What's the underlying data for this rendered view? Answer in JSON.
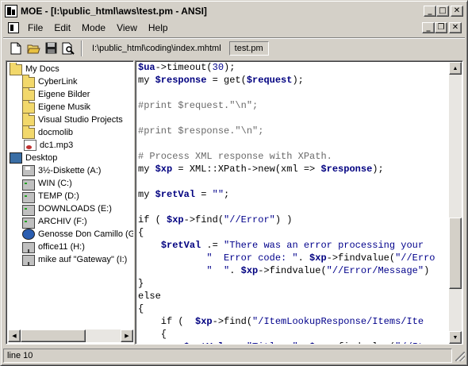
{
  "window": {
    "title": "MOE - [I:\\public_html\\aws\\test.pm - ANSI]",
    "buttons": {
      "minimize": "_",
      "maximize": "□",
      "close": "✕"
    }
  },
  "menubar": {
    "items": [
      "File",
      "Edit",
      "Mode",
      "View",
      "Help"
    ],
    "doc_buttons": {
      "minimize": "_",
      "restore": "❐",
      "close": "✕"
    }
  },
  "toolbar": {
    "icons": [
      "new-file-icon",
      "open-folder-icon",
      "save-disk-icon",
      "print-preview-icon"
    ],
    "tabs": [
      {
        "label": "I:\\public_html\\coding\\index.mhtml",
        "active": false
      },
      {
        "label": "test.pm",
        "active": true
      }
    ]
  },
  "tree": {
    "items": [
      {
        "label": "My Docs",
        "icon": "folder-icon",
        "level": 0
      },
      {
        "label": "CyberLink",
        "icon": "folder-icon",
        "level": 1
      },
      {
        "label": "Eigene Bilder",
        "icon": "folder-icon",
        "level": 1
      },
      {
        "label": "Eigene Musik",
        "icon": "folder-icon",
        "level": 1
      },
      {
        "label": "Visual Studio Projects",
        "icon": "folder-icon",
        "level": 1
      },
      {
        "label": "docmolib",
        "icon": "folder-icon",
        "level": 1
      },
      {
        "label": "dc1.mp3",
        "icon": "audio-file-icon",
        "level": 1
      },
      {
        "label": "Desktop",
        "icon": "desktop-icon",
        "level": 0
      },
      {
        "label": "3½-Diskette (A:)",
        "icon": "floppy-icon",
        "level": 1
      },
      {
        "label": "WIN (C:)",
        "icon": "drive-icon",
        "level": 1
      },
      {
        "label": "TEMP (D:)",
        "icon": "drive-icon",
        "level": 1
      },
      {
        "label": "DOWNLOADS (E:)",
        "icon": "drive-icon",
        "level": 1
      },
      {
        "label": "ARCHIV (F:)",
        "icon": "drive-icon",
        "level": 1
      },
      {
        "label": "Genosse Don Camillo (G:)",
        "icon": "network-icon",
        "level": 1
      },
      {
        "label": "office11 (H:)",
        "icon": "network-drive-icon",
        "level": 1
      },
      {
        "label": "mike auf \"Gateway\" (I:)",
        "icon": "network-drive-icon",
        "level": 1
      }
    ]
  },
  "editor": {
    "lines": [
      [
        [
          "var",
          "$ua"
        ],
        [
          "plain",
          "->timeout("
        ],
        [
          "str",
          "30"
        ],
        [
          "plain",
          ");"
        ]
      ],
      [
        [
          "plain",
          "my "
        ],
        [
          "var",
          "$response"
        ],
        [
          "plain",
          " = get("
        ],
        [
          "var",
          "$request"
        ],
        [
          "plain",
          ");"
        ]
      ],
      [
        [
          "plain",
          ""
        ]
      ],
      [
        [
          "cmt",
          "#print $request.\"\\n\";"
        ]
      ],
      [
        [
          "plain",
          ""
        ]
      ],
      [
        [
          "cmt",
          "#print $response.\"\\n\";"
        ]
      ],
      [
        [
          "plain",
          ""
        ]
      ],
      [
        [
          "cmt",
          "# Process XML response with XPath."
        ]
      ],
      [
        [
          "plain",
          "my "
        ],
        [
          "var",
          "$xp"
        ],
        [
          "plain",
          " = XML::XPath->new(xml => "
        ],
        [
          "var",
          "$response"
        ],
        [
          "plain",
          ");"
        ]
      ],
      [
        [
          "plain",
          ""
        ]
      ],
      [
        [
          "plain",
          "my "
        ],
        [
          "var",
          "$retVal"
        ],
        [
          "plain",
          " = "
        ],
        [
          "str",
          "\"\""
        ],
        [
          "plain",
          ";"
        ]
      ],
      [
        [
          "plain",
          ""
        ]
      ],
      [
        [
          "plain",
          "if ( "
        ],
        [
          "var",
          "$xp"
        ],
        [
          "plain",
          "->find("
        ],
        [
          "str",
          "\"//Error\""
        ],
        [
          "plain",
          ") )"
        ]
      ],
      [
        [
          "plain",
          "{"
        ]
      ],
      [
        [
          "plain",
          "    "
        ],
        [
          "var",
          "$retVal"
        ],
        [
          "plain",
          " .= "
        ],
        [
          "str",
          "\"There was an error processing your"
        ]
      ],
      [
        [
          "str",
          "            \"  Error code: \""
        ],
        [
          "plain",
          ". "
        ],
        [
          "var",
          "$xp"
        ],
        [
          "plain",
          "->findvalue("
        ],
        [
          "str",
          "\"//Erro"
        ]
      ],
      [
        [
          "str",
          "            \"  \""
        ],
        [
          "plain",
          ". "
        ],
        [
          "var",
          "$xp"
        ],
        [
          "plain",
          "->findvalue("
        ],
        [
          "str",
          "\"//Error/Message\""
        ],
        [
          "plain",
          ")"
        ]
      ],
      [
        [
          "plain",
          "}"
        ]
      ],
      [
        [
          "plain",
          "else"
        ]
      ],
      [
        [
          "plain",
          "{"
        ]
      ],
      [
        [
          "plain",
          "    if (  "
        ],
        [
          "var",
          "$xp"
        ],
        [
          "plain",
          "->find("
        ],
        [
          "str",
          "\"/ItemLookupResponse/Items/Ite"
        ]
      ],
      [
        [
          "plain",
          "    {"
        ]
      ],
      [
        [
          "plain",
          "        "
        ],
        [
          "var",
          "$retVal"
        ],
        [
          "plain",
          " .= "
        ],
        [
          "str",
          "\"Title: \""
        ],
        [
          "plain",
          ". "
        ],
        [
          "var",
          "$xp"
        ],
        [
          "plain",
          "->findvalue("
        ],
        [
          "str",
          "\"//It"
        ]
      ]
    ]
  },
  "statusbar": {
    "text": "line 10"
  }
}
